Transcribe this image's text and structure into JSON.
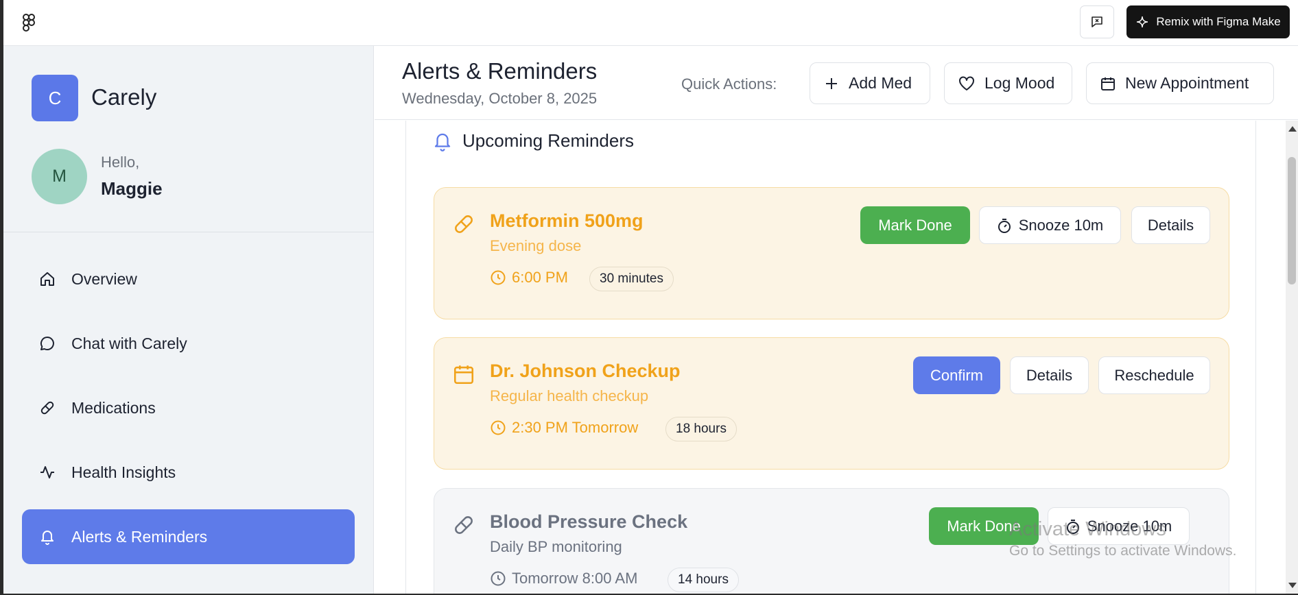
{
  "topbar": {
    "logo_icon": "figma-logo-icon",
    "feedback_icon": "feedback-icon",
    "remix_label": "Remix with Figma Make",
    "remix_icon": "sparkle-icon"
  },
  "sidebar": {
    "brand_initial": "C",
    "brand_name": "Carely",
    "user_initial": "M",
    "greeting": "Hello,",
    "user_name": "Maggie",
    "items": [
      {
        "label": "Overview",
        "icon": "home-icon",
        "active": false
      },
      {
        "label": "Chat with Carely",
        "icon": "chat-bubble-icon",
        "active": false
      },
      {
        "label": "Medications",
        "icon": "pill-icon",
        "active": false
      },
      {
        "label": "Health Insights",
        "icon": "activity-icon",
        "active": false
      },
      {
        "label": "Alerts & Reminders",
        "icon": "bell-icon",
        "active": true
      }
    ]
  },
  "header": {
    "title": "Alerts & Reminders",
    "date": "Wednesday, October 8, 2025",
    "quick_actions_label": "Quick Actions:",
    "quick_actions": [
      {
        "label": "Add Med",
        "icon": "plus-icon"
      },
      {
        "label": "Log Mood",
        "icon": "heart-icon"
      },
      {
        "label": "New Appointment",
        "icon": "calendar-icon"
      }
    ]
  },
  "section": {
    "title": "Upcoming Reminders",
    "icon": "bell-icon"
  },
  "reminders": [
    {
      "title": "Metformin 500mg",
      "subtitle": "Evening dose",
      "time": "6:00 PM",
      "badge": "30 minutes",
      "icon": "pill-icon",
      "status": "warning",
      "actions": [
        "Mark Done",
        "Snooze 10m",
        "Details"
      ]
    },
    {
      "title": "Dr. Johnson Checkup",
      "subtitle": "Regular health checkup",
      "time": "2:30 PM Tomorrow",
      "badge": "18 hours",
      "icon": "calendar-icon",
      "status": "warning",
      "actions": [
        "Confirm",
        "Details",
        "Reschedule"
      ]
    },
    {
      "title": "Blood Pressure Check",
      "subtitle": "Daily BP monitoring",
      "time": "Tomorrow 8:00 AM",
      "badge": "14 hours",
      "icon": "pill-icon",
      "status": "normal",
      "actions": [
        "Mark Done",
        "Snooze 10m"
      ]
    }
  ],
  "watermark": {
    "line1": "Activate Windows",
    "line2": "Go to Settings to activate Windows."
  },
  "colors": {
    "accent": "#5e7be9",
    "success": "#4caf50",
    "warning": "#f0a21a",
    "warning_bg": "#fcf4e4"
  }
}
